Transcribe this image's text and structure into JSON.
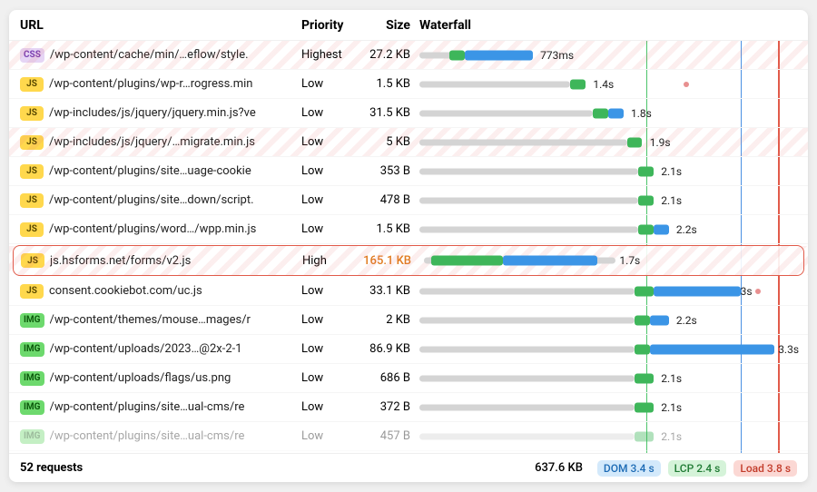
{
  "columns": {
    "url": "URL",
    "priority": "Priority",
    "size": "Size",
    "waterfall": "Waterfall"
  },
  "waterfall": {
    "max_ms": 4000,
    "markers": {
      "lcp_ms": 2400,
      "dom_ms": 3400,
      "load_ms": 3800
    }
  },
  "rows": [
    {
      "type": "CSS",
      "url": "/wp-content/cache/min/…eflow/style.",
      "priority": "Highest",
      "size": "27.2 KB",
      "time": "773ms",
      "hatched": true,
      "track": {
        "bg_start": 0,
        "bg_end": 19,
        "green_start": 8,
        "green_end": 12,
        "blue_start": 12,
        "blue_end": 30,
        "label_at": 32
      }
    },
    {
      "type": "JS",
      "url": "/wp-content/plugins/wp-r…rogress.min",
      "priority": "Low",
      "size": "1.5 KB",
      "time": "1.4s",
      "dot_at": 70,
      "track": {
        "bg_start": 0,
        "bg_end": 40,
        "green_start": 40,
        "green_end": 44,
        "label_at": 46
      }
    },
    {
      "type": "JS",
      "url": "/wp-includes/js/jquery/jquery.min.js?ve",
      "priority": "Low",
      "size": "31.5 KB",
      "time": "1.8s",
      "track": {
        "bg_start": 0,
        "bg_end": 46,
        "green_start": 46,
        "green_end": 50,
        "blue_start": 50,
        "blue_end": 54,
        "label_at": 56
      }
    },
    {
      "type": "JS",
      "url": "/wp-includes/js/jquery/…migrate.min.js",
      "priority": "Low",
      "size": "5 KB",
      "time": "1.9s",
      "hatched": true,
      "track": {
        "bg_start": 0,
        "bg_end": 55,
        "green_start": 55,
        "green_end": 59,
        "label_at": 61
      }
    },
    {
      "type": "JS",
      "url": "/wp-content/plugins/site…uage-cookie",
      "priority": "Low",
      "size": "353 B",
      "time": "2.1s",
      "track": {
        "bg_start": 0,
        "bg_end": 58,
        "green_start": 58,
        "green_end": 62,
        "label_at": 64
      }
    },
    {
      "type": "JS",
      "url": "/wp-content/plugins/site…down/script.",
      "priority": "Low",
      "size": "478 B",
      "time": "2.1s",
      "track": {
        "bg_start": 0,
        "bg_end": 58,
        "green_start": 58,
        "green_end": 62,
        "label_at": 64
      }
    },
    {
      "type": "JS",
      "url": "/wp-content/plugins/word…/wpp.min.js",
      "priority": "Low",
      "size": "1.5 KB",
      "time": "2.2s",
      "track": {
        "bg_start": 0,
        "bg_end": 58,
        "green_start": 58,
        "green_end": 62,
        "blue_start": 62,
        "blue_end": 66,
        "label_at": 68
      }
    },
    {
      "type": "JS",
      "url": "js.hsforms.net/forms/v2.js",
      "priority": "High",
      "size": "165.1 KB",
      "size_highlight": true,
      "time": "1.7s",
      "highlighted": true,
      "hatched": true,
      "track": {
        "bg_start": 1,
        "bg_end": 52,
        "green_start": 3,
        "green_end": 22,
        "blue_start": 22,
        "blue_end": 47,
        "label_at": 53
      }
    },
    {
      "type": "JS",
      "url": "consent.cookiebot.com/uc.js",
      "priority": "Low",
      "size": "33.1 KB",
      "time": "3s",
      "dot_at": 89,
      "track": {
        "bg_start": 0,
        "bg_end": 57,
        "green_start": 57,
        "green_end": 62,
        "blue_start": 62,
        "blue_end": 85,
        "label_at": 85
      }
    },
    {
      "type": "IMG",
      "url": "/wp-content/themes/mouse…mages/r",
      "priority": "Low",
      "size": "2 KB",
      "time": "2.2s",
      "track": {
        "bg_start": 0,
        "bg_end": 57,
        "green_start": 57,
        "green_end": 61,
        "blue_start": 61,
        "blue_end": 66,
        "label_at": 68
      }
    },
    {
      "type": "IMG",
      "url": "/wp-content/uploads/2023…@2x-2-1",
      "priority": "Low",
      "size": "86.9 KB",
      "time": "3.3s",
      "track": {
        "bg_start": 0,
        "bg_end": 57,
        "green_start": 57,
        "green_end": 61,
        "blue_start": 61,
        "blue_end": 94,
        "label_at": 95
      }
    },
    {
      "type": "IMG",
      "url": "/wp-content/uploads/flags/us.png",
      "priority": "Low",
      "size": "686 B",
      "time": "2.1s",
      "track": {
        "bg_start": 0,
        "bg_end": 57,
        "green_start": 57,
        "green_end": 62,
        "label_at": 64
      }
    },
    {
      "type": "IMG",
      "url": "/wp-content/plugins/site…ual-cms/re",
      "priority": "Low",
      "size": "372 B",
      "time": "2.1s",
      "track": {
        "bg_start": 0,
        "bg_end": 57,
        "green_start": 57,
        "green_end": 62,
        "label_at": 64
      }
    },
    {
      "type": "IMG",
      "url": "/wp-content/plugins/site…ual-cms/re",
      "priority": "Low",
      "size": "457 B",
      "time": "2.1s",
      "faded": true,
      "track": {
        "bg_start": 0,
        "bg_end": 57,
        "green_start": 57,
        "green_end": 62,
        "label_at": 64
      }
    }
  ],
  "footer": {
    "requests": "52 requests",
    "total_size": "637.6 KB",
    "dom": "DOM 3.4 s",
    "lcp": "LCP 2.4 s",
    "load": "Load 3.8 s"
  }
}
